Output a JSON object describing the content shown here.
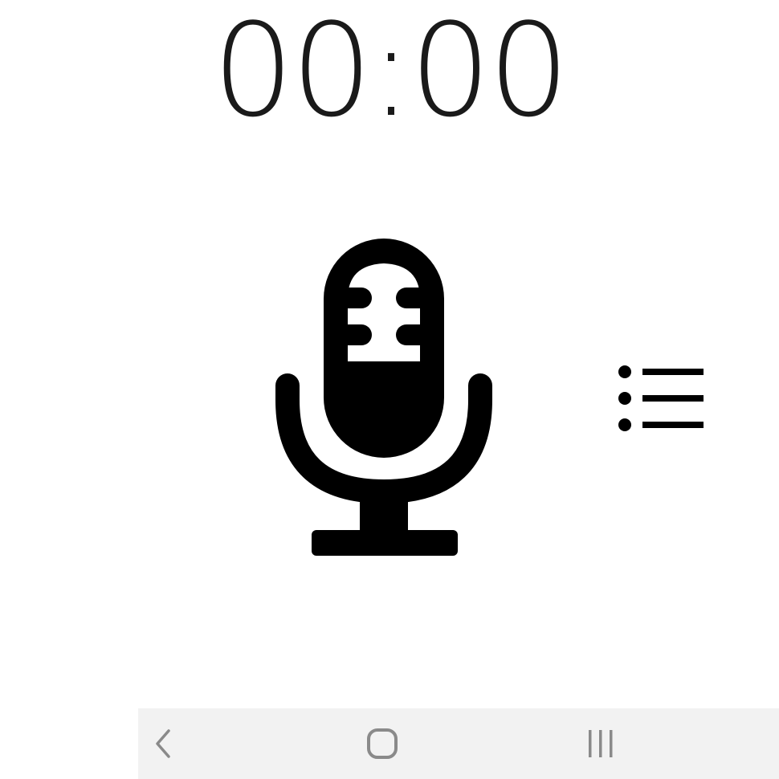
{
  "timer": {
    "elapsed": "00:00"
  },
  "icons": {
    "record": "microphone-icon",
    "list": "list-icon",
    "back": "back-chevron-icon",
    "home": "home-icon",
    "recents": "recent-apps-icon"
  },
  "colors": {
    "background": "#ffffff",
    "icon": "#000000",
    "navbar_background": "#f2f2f2",
    "navbar_icon": "#8a8a8a"
  }
}
